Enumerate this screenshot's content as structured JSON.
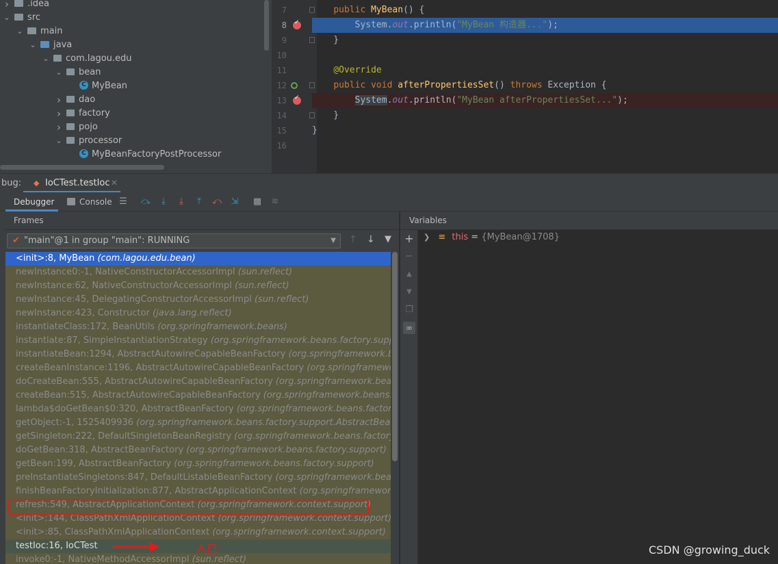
{
  "project_tree": {
    "items": [
      {
        "label": ".idea",
        "depth": 0,
        "expanded": false,
        "kind": "folder"
      },
      {
        "label": "src",
        "depth": 0,
        "expanded": true,
        "kind": "folder"
      },
      {
        "label": "main",
        "depth": 1,
        "expanded": true,
        "kind": "folder"
      },
      {
        "label": "java",
        "depth": 2,
        "expanded": true,
        "kind": "folder-blue"
      },
      {
        "label": "com.lagou.edu",
        "depth": 3,
        "expanded": true,
        "kind": "package"
      },
      {
        "label": "bean",
        "depth": 4,
        "expanded": true,
        "kind": "package"
      },
      {
        "label": "MyBean",
        "depth": 5,
        "expanded": null,
        "kind": "class"
      },
      {
        "label": "dao",
        "depth": 4,
        "expanded": false,
        "kind": "package"
      },
      {
        "label": "factory",
        "depth": 4,
        "expanded": false,
        "kind": "package"
      },
      {
        "label": "pojo",
        "depth": 4,
        "expanded": false,
        "kind": "package"
      },
      {
        "label": "processor",
        "depth": 4,
        "expanded": true,
        "kind": "package"
      },
      {
        "label": "MyBeanFactoryPostProcessor",
        "depth": 5,
        "expanded": null,
        "kind": "class"
      }
    ]
  },
  "editor": {
    "lines": [
      {
        "n": "7",
        "text": "public MyBean() {"
      },
      {
        "n": "8",
        "text": "System.out.println(\"MyBean 构造器...\");"
      },
      {
        "n": "9",
        "text": "}"
      },
      {
        "n": "10",
        "text": ""
      },
      {
        "n": "11",
        "text": "@Override"
      },
      {
        "n": "12",
        "text": "public void afterPropertiesSet() throws Exception {"
      },
      {
        "n": "13",
        "text": "System.out.println(\"MyBean afterPropertiesSet...\");"
      },
      {
        "n": "14",
        "text": "}"
      },
      {
        "n": "15",
        "text": "}"
      },
      {
        "n": "16",
        "text": ""
      }
    ]
  },
  "debug": {
    "label": "bug:",
    "session_tab": "IoCTest.testIoc",
    "tabs": {
      "debugger": "Debugger",
      "console": "Console"
    }
  },
  "frames": {
    "header": "Frames",
    "thread": "\"main\"@1 in group \"main\": RUNNING",
    "list": [
      {
        "method": "<init>:8, MyBean",
        "pkg": "(com.lagou.edu.bean)",
        "state": "selected"
      },
      {
        "method": "newInstance0:-1, NativeConstructorAccessorImpl",
        "pkg": "(sun.reflect)",
        "state": "lib"
      },
      {
        "method": "newInstance:62, NativeConstructorAccessorImpl",
        "pkg": "(sun.reflect)",
        "state": "lib"
      },
      {
        "method": "newInstance:45, DelegatingConstructorAccessorImpl",
        "pkg": "(sun.reflect)",
        "state": "lib"
      },
      {
        "method": "newInstance:423, Constructor",
        "pkg": "(java.lang.reflect)",
        "state": "lib"
      },
      {
        "method": "instantiateClass:172, BeanUtils",
        "pkg": "(org.springframework.beans)",
        "state": "lib"
      },
      {
        "method": "instantiate:87, SimpleInstantiationStrategy",
        "pkg": "(org.springframework.beans.factory.support)",
        "state": "lib"
      },
      {
        "method": "instantiateBean:1294, AbstractAutowireCapableBeanFactory",
        "pkg": "(org.springframework.beans.",
        "state": "lib"
      },
      {
        "method": "createBeanInstance:1196, AbstractAutowireCapableBeanFactory",
        "pkg": "(org.springframework.be",
        "state": "lib"
      },
      {
        "method": "doCreateBean:555, AbstractAutowireCapableBeanFactory",
        "pkg": "(org.springframework.beans.fa",
        "state": "lib"
      },
      {
        "method": "createBean:515, AbstractAutowireCapableBeanFactory",
        "pkg": "(org.springframework.beans.factor",
        "state": "lib"
      },
      {
        "method": "lambda$doGetBean$0:320, AbstractBeanFactory",
        "pkg": "(org.springframework.beans.factory.sup",
        "state": "lib"
      },
      {
        "method": "getObject:-1, 1525409936",
        "pkg": "(org.springframework.beans.factory.support.AbstractBeanFact",
        "state": "lib"
      },
      {
        "method": "getSingleton:222, DefaultSingletonBeanRegistry",
        "pkg": "(org.springframework.beans.factory.supp",
        "state": "lib"
      },
      {
        "method": "doGetBean:318, AbstractBeanFactory",
        "pkg": "(org.springframework.beans.factory.support)",
        "state": "lib"
      },
      {
        "method": "getBean:199, AbstractBeanFactory",
        "pkg": "(org.springframework.beans.factory.support)",
        "state": "lib"
      },
      {
        "method": "preInstantiateSingletons:847, DefaultListableBeanFactory",
        "pkg": "(org.springframework.beans.fac",
        "state": "lib"
      },
      {
        "method": "finishBeanFactoryInitialization:877, AbstractApplicationContext",
        "pkg": "(org.springframework.con",
        "state": "lib"
      },
      {
        "method": "refresh:549, AbstractApplicationContext",
        "pkg": "(org.springframework.context.support)",
        "state": "lib"
      },
      {
        "method": "<init>:144, ClassPathXmlApplicationContext",
        "pkg": "(org.springframework.context.support)",
        "state": "lib"
      },
      {
        "method": "<init>:85, ClassPathXmlApplicationContext",
        "pkg": "(org.springframework.context.support)",
        "state": "lib"
      },
      {
        "method": "testIoc:16, IoCTest",
        "pkg": "",
        "state": "own"
      },
      {
        "method": "invoke0:-1, NativeMethodAccessorImpl",
        "pkg": "(sun.reflect)",
        "state": "lib"
      }
    ]
  },
  "variables": {
    "header": "Variables",
    "row": {
      "name": "this",
      "eq": " = ",
      "value": "{MyBean@1708}"
    }
  },
  "annotation": {
    "text": "入口",
    "color": "#e21b1b"
  },
  "watermark": "CSDN @growing_duck",
  "colors": {
    "selected_frame": "#2f65ca",
    "library_frame_bg": "#5c5a3f",
    "own_frame_bg": "#49574a",
    "exec_line": "#2d5b9a",
    "breakpoint": "#db5c5c"
  }
}
